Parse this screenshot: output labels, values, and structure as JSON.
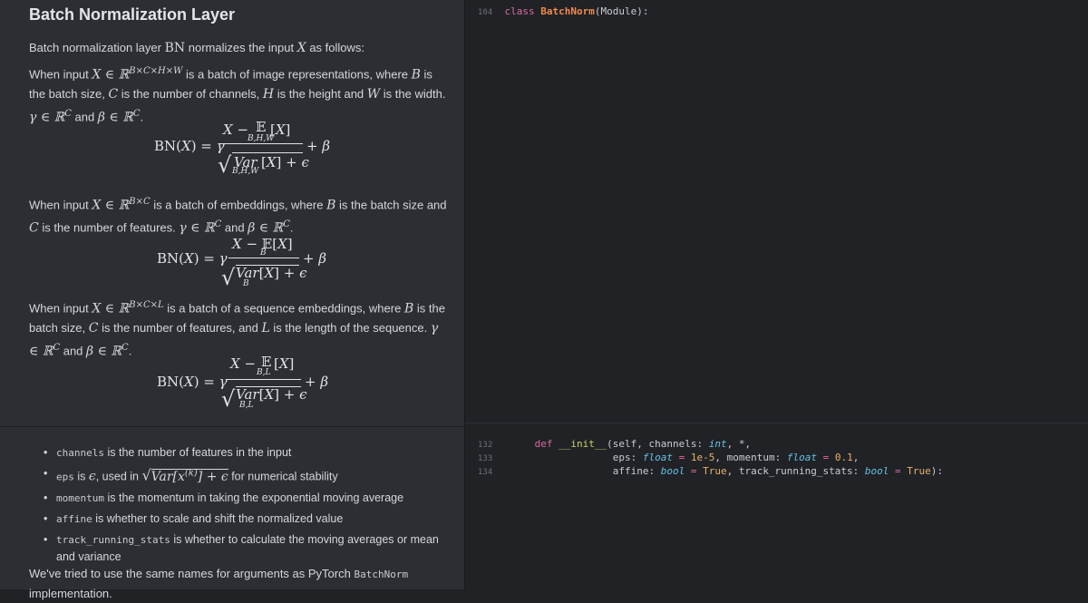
{
  "doc": {
    "title": "Batch Normalization Layer",
    "intro": "Batch normalization layer",
    "intro_sym": "BN",
    "intro_rest": "normalizes the input",
    "intro_x": "X",
    "intro_end": "as follows:",
    "case1_a": "When input",
    "case1_sym": "X ∈ ℝ",
    "case1_sup": "B×C×H×W",
    "case1_b": "is a batch of image representations, where",
    "case1_c": "is the batch size,",
    "case1_d": "is the number of channels,",
    "case1_e": "is the height and",
    "case1_f": "is the width.",
    "case1_g": "and",
    "case2_sup": "B×C",
    "case2_b": "is a batch of embeddings, where",
    "case2_c": "is the batch size and",
    "case2_d": "is the number of features.",
    "case3_sup": "B×C×L",
    "case3_b": "is a batch of a sequence embeddings, where",
    "case3_c": "is the batch size,",
    "case3_d": "is the number of features, and",
    "case3_e": "is the length of the sequence.",
    "bullets": [
      {
        "code": "channels",
        "text": "is the number of features in the input"
      },
      {
        "code": "eps",
        "text_a": "is",
        "text_b": ", used in",
        "text_c": "for numerical stability"
      },
      {
        "code": "momentum",
        "text": "is the momentum in taking the exponential moving average"
      },
      {
        "code": "affine",
        "text": "is whether to scale and shift the normalized value"
      },
      {
        "code": "track_running_stats",
        "text": "is whether to calculate the moving averages or mean and variance"
      }
    ],
    "footer_a": "We've tried to use the same names for arguments as PyTorch",
    "footer_code": "BatchNorm",
    "footer_b": "implementation."
  },
  "code": {
    "line1_no": "104",
    "line1_kw": "class",
    "line1_cls": "BatchNorm",
    "line1_rest": "(Module):",
    "line2_no": "132",
    "line3_no": "133",
    "line4_no": "134",
    "def_kw": "def",
    "init": "__init__",
    "self": "(self, channels:",
    "int": "int",
    "star": ", *,",
    "eps": "eps:",
    "float": "float",
    "eq": "=",
    "eps_val": "1e-5",
    "momentum": ", momentum:",
    "mom_val": "0.1",
    "affine": "affine:",
    "bool": "bool",
    "true": "True",
    "trs": ", track_running_stats:",
    "close": "):"
  },
  "colors": {
    "doc_bg": "#2b2e33",
    "code_bg": "#202226",
    "keyword": "#d96b9e",
    "class": "#f08a4b",
    "function": "#c7d264",
    "type": "#67c1e8"
  }
}
